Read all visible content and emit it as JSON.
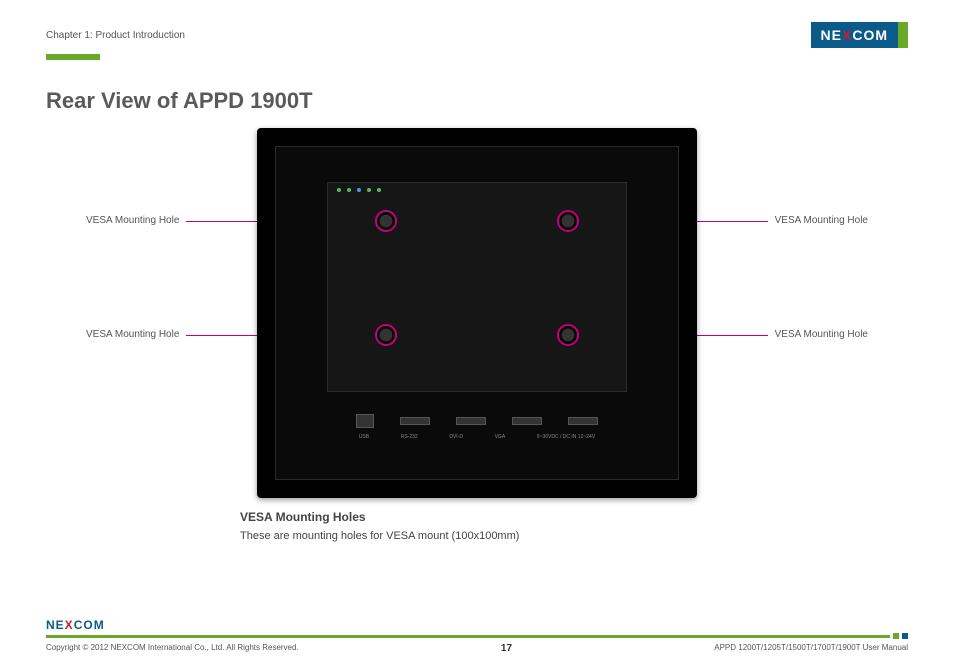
{
  "header": {
    "chapter": "Chapter 1: Product Introduction",
    "brand_pre": "NE",
    "brand_x": "X",
    "brand_post": "COM"
  },
  "title": "Rear View of APPD 1900T",
  "callouts": {
    "top_left": "VESA Mounting Hole",
    "top_right": "VESA Mounting Hole",
    "bottom_left": "VESA Mounting Hole",
    "bottom_right": "VESA Mounting Hole"
  },
  "ports": [
    "USB",
    "RS-232",
    "DVI-D",
    "VGA",
    "9~36VDC / DC IN 12~24V"
  ],
  "section": {
    "heading": "VESA Mounting Holes",
    "text": "These are mounting holes for VESA mount (100x100mm)"
  },
  "footer": {
    "copyright": "Copyright © 2012 NEXCOM International Co., Ltd. All Rights Reserved.",
    "page": "17",
    "doc": "APPD 1200T/1205T/1500T/1700T/1900T User Manual"
  }
}
